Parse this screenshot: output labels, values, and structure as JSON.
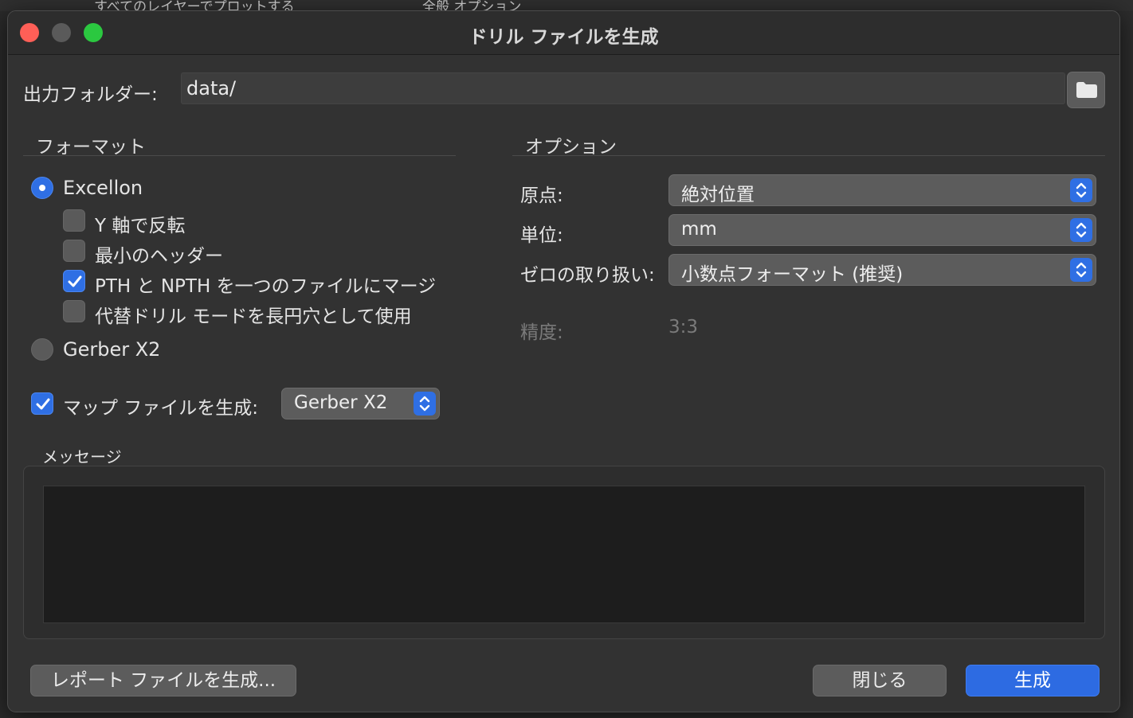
{
  "background": {
    "peek_left": "すべてのレイヤーでプロットする",
    "peek_right": "全般 オプション"
  },
  "dialog": {
    "title": "ドリル ファイルを生成",
    "output_folder_label": "出力フォルダー:",
    "output_folder_value": "data/",
    "format": {
      "title": "フォーマット",
      "excellon_label": "Excellon",
      "excellon_selected": true,
      "options": [
        {
          "label": "Y 軸で反転",
          "checked": false
        },
        {
          "label": "最小のヘッダー",
          "checked": false
        },
        {
          "label": "PTH と NPTH を一つのファイルにマージ",
          "checked": true
        },
        {
          "label": "代替ドリル モードを長円穴として使用",
          "checked": false
        }
      ],
      "gerber_label": "Gerber X2",
      "gerber_selected": false,
      "map_file_label": "マップ ファイルを生成:",
      "map_file_checked": true,
      "map_format_value": "Gerber X2"
    },
    "options": {
      "title": "オプション",
      "origin_label": "原点:",
      "origin_value": "絶対位置",
      "units_label": "単位:",
      "units_value": "mm",
      "zeros_label": "ゼロの取り扱い:",
      "zeros_value": "小数点フォーマット (推奨)",
      "precision_label": "精度:",
      "precision_value": "3:3"
    },
    "messages_title": "メッセージ",
    "buttons": {
      "report": "レポート ファイルを生成...",
      "close": "閉じる",
      "generate": "生成"
    }
  },
  "colors": {
    "accent": "#2f6fe4",
    "window_bg": "#323232",
    "close_light": "#fe5f57",
    "zoom_light": "#2bc840"
  }
}
